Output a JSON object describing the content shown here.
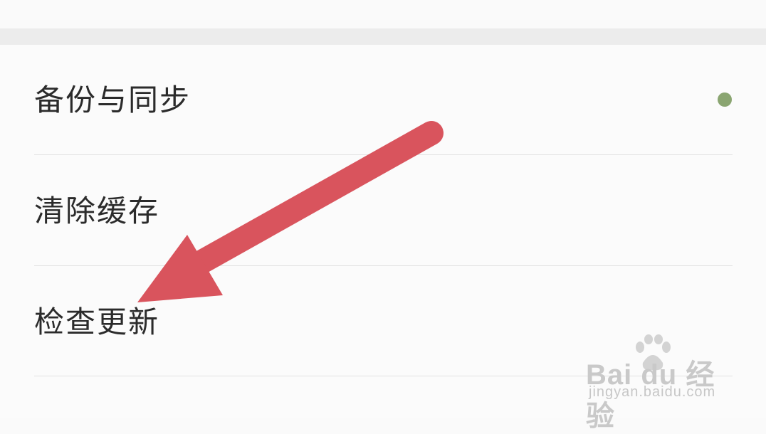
{
  "settings": {
    "items": [
      {
        "label": "备份与同步",
        "has_dot": true
      },
      {
        "label": "清除缓存"
      },
      {
        "label": "检查更新"
      }
    ]
  },
  "colors": {
    "dot": "#8aa571",
    "arrow": "#d9545d",
    "section_gap": "#ececec"
  },
  "watermark": {
    "logo": "Bai du 经验",
    "url": "jingyan.baidu.com"
  }
}
